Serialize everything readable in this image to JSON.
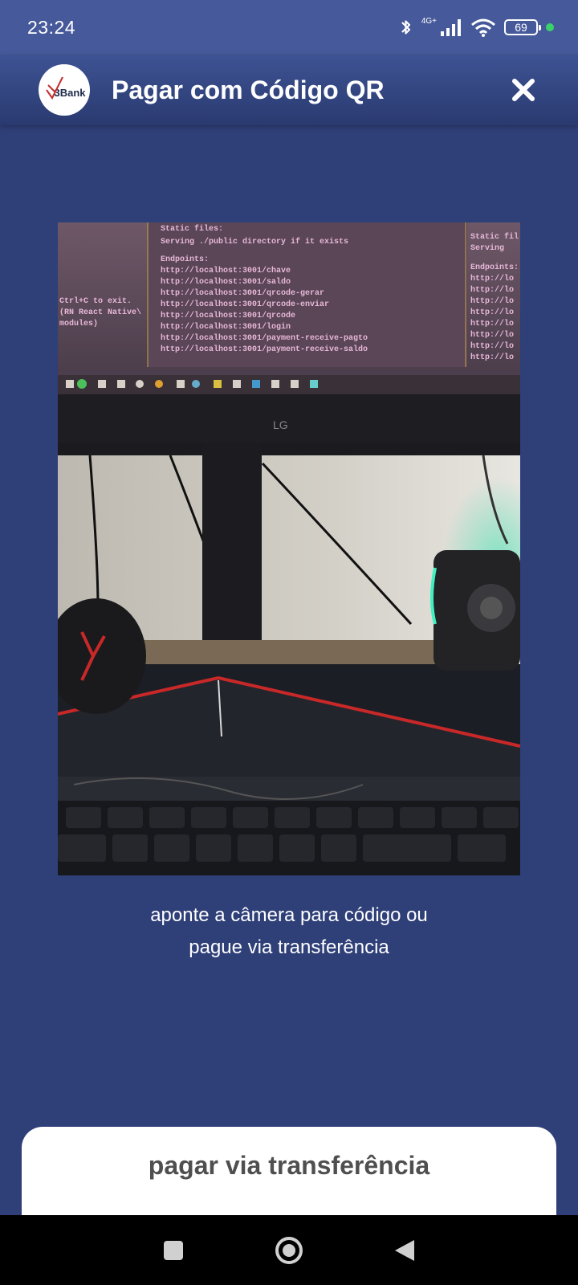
{
  "status_bar": {
    "time": "23:24",
    "network_label": "4G+",
    "battery_level": "69",
    "icons": [
      "bluetooth-icon",
      "signal-icon",
      "wifi-icon",
      "battery-icon",
      "active-dot"
    ]
  },
  "header": {
    "logo_text": "3Bank",
    "title": "Pagar com Código QR",
    "close_icon": "close-icon"
  },
  "camera": {
    "description_icon": "camera-preview",
    "terminal_lines": [
      "Static files:",
      "Serving ./public directory if it exists",
      "Endpoints:",
      "http://localhost:3001/chave",
      "http://localhost:3001/saldo",
      "http://localhost:3001/qrcode-gerar",
      "http://localhost:3001/qrcode-enviar",
      "http://localhost:3001/qrcode",
      "http://localhost:3001/login",
      "http://localhost:3001/payment-receive-pagto",
      "http://localhost:3001/payment-receive-saldo"
    ],
    "left_pane_lines": [
      "Ctrl+C to exit.",
      "(RN React Native\\",
      "modules)"
    ],
    "right_pane_lines": [
      "Static fil",
      "Serving",
      "Endpoints:",
      "http://lo",
      "http://lo",
      "http://lo",
      "http://lo",
      "http://lo",
      "http://lo",
      "http://lo",
      "http://lo"
    ],
    "monitor_brand": "LG"
  },
  "instruction": {
    "line1": "aponte a câmera para código ou",
    "line2": "pague via transferência"
  },
  "transfer_button": {
    "label": "pagar via transferência"
  },
  "nav_bar": {
    "icons": [
      "recent-apps-icon",
      "home-icon",
      "back-icon"
    ]
  },
  "colors": {
    "background": "#2f3f78",
    "header": "#3e5394",
    "status_bar": "#46599a",
    "card": "#ffffff",
    "card_text": "#4f4f4f"
  }
}
